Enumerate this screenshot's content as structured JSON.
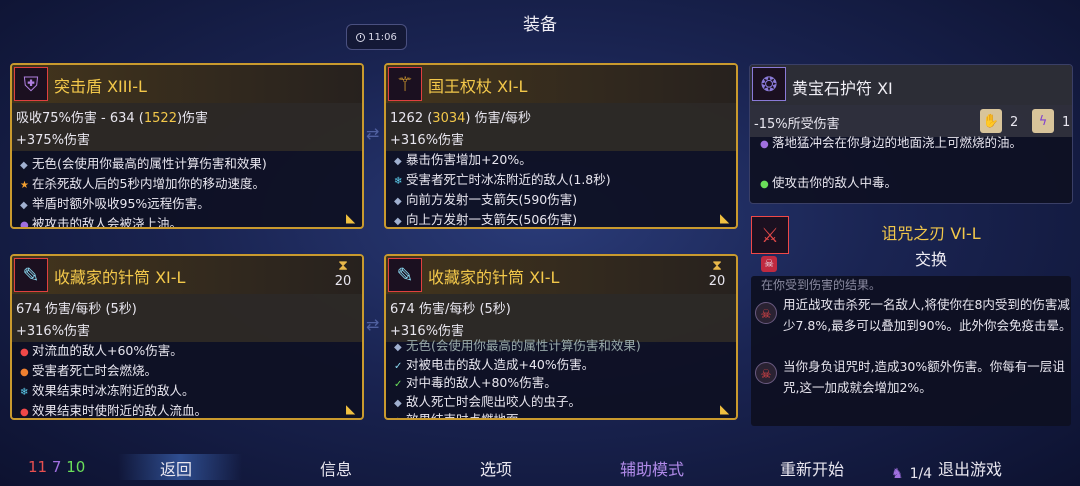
{
  "title": "装备",
  "clock": "11:06",
  "cards": [
    {
      "name": "突击盾 XIII-L",
      "icon": "shield-icon",
      "stat1_pre": "吸收75%伤害 - 634 (",
      "stat1_hl": "1522",
      "stat1_post": ")伤害",
      "stat2": "+375%伤害",
      "effects": [
        "无色(会使用你最高的属性计算伤害和效果)",
        "在杀死敌人后的5秒内增加你的移动速度。",
        "举盾时额外吸收95%远程伤害。",
        "被攻击的敌人会被浇上油。"
      ]
    },
    {
      "name": "国王权杖 XI-L",
      "icon": "scepter-icon",
      "stat1_pre": "1262 (",
      "stat1_hl": "3034",
      "stat1_post": ") 伤害/每秒",
      "stat2": "+316%伤害",
      "effects": [
        "暴击伤害增加+20%。",
        "受害者死亡时冰冻附近的敌人(1.8秒)",
        "向前方发射一支箭矢(590伤害)",
        "向上方发射一支箭矢(506伤害)"
      ]
    },
    {
      "name": "收藏家的针筒 XI-L",
      "icon": "syringe-icon",
      "count": "20",
      "stat1": "674 伤害/每秒 (5秒)",
      "stat2": "+316%伤害",
      "effects": [
        "对流血的敌人+60%伤害。",
        "受害者死亡时会燃烧。",
        "效果结束时冰冻附近的敌人。",
        "效果结束时使附近的敌人流血。"
      ]
    },
    {
      "name": "收藏家的针筒 XI-L",
      "icon": "syringe-icon",
      "count": "20",
      "stat1": "674 伤害/每秒 (5秒)",
      "stat2": "+316%伤害",
      "effects": [
        "无色(会使用你最高的属性计算伤害和效果)",
        "对被电击的敌人造成+40%伤害。",
        "对中毒的敌人+80%伤害。",
        "敌人死亡时会爬出咬人的虫子。",
        "效果结束时点燃地面"
      ]
    }
  ],
  "right_top": {
    "name": "黄宝石护符 XI",
    "stat": "-15%所受伤害",
    "rune1_count": "2",
    "rune2_count": "1",
    "effects": [
      "落地猛冲会在你身边的地面浇上可燃烧的油。",
      "使攻击你的敌人中毒。"
    ]
  },
  "right_bottom": {
    "name": "诅咒之刃 VI-L",
    "swap": "交换",
    "faded": "在你受到伤害的结果。",
    "perk1": "用近战攻击杀死一名敌人,将使你在8内受到的伤害减少7.8%,最多可以叠加到90%。此外你会免疫击晕。",
    "perk2": "当你身负诅咒时,造成30%额外伤害。你每有一层诅咒,这一加成就会增加2%。",
    "page": "1/4"
  },
  "resources": {
    "red": "11",
    "purple": "7",
    "green": "10"
  },
  "menu": {
    "back": "返回",
    "info": "信息",
    "options": "选项",
    "assist": "辅助模式",
    "restart": "重新开始",
    "quit": "退出游戏"
  },
  "colors": {
    "accent_gold": "#f3c84a",
    "assist_purple": "#b08ae8",
    "card_border": "#c99a2e"
  }
}
